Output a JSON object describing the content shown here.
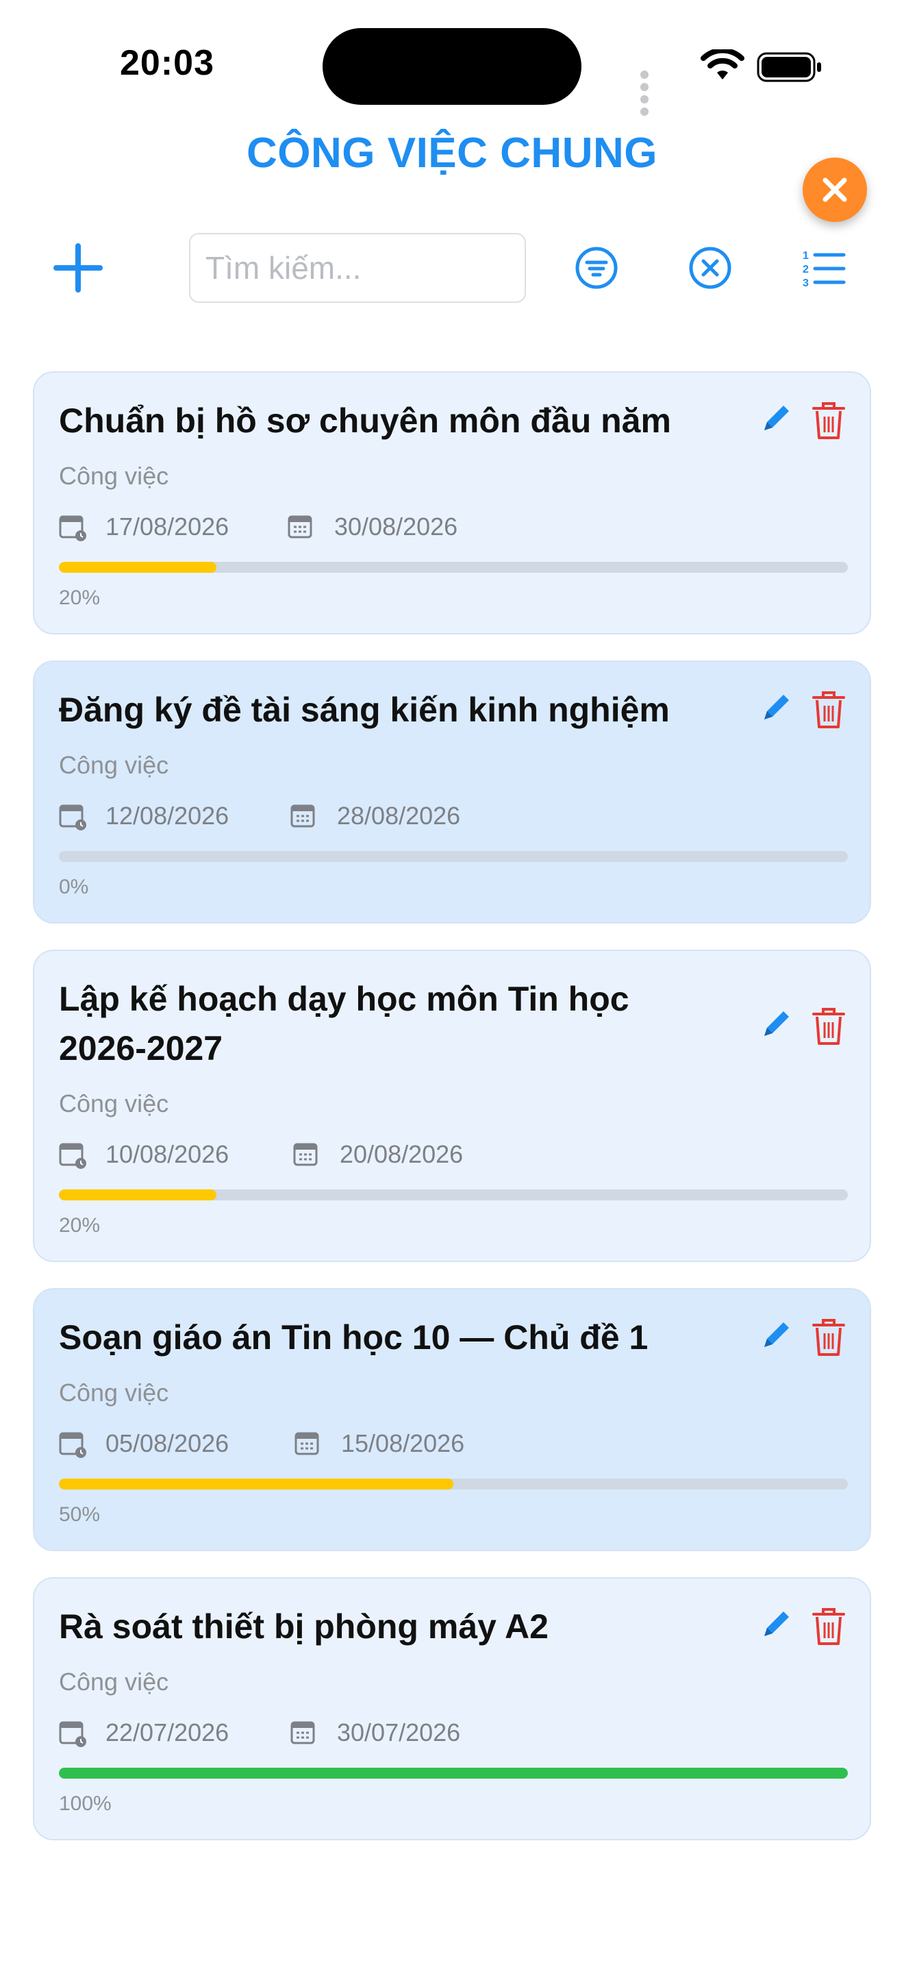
{
  "status": {
    "time": "20:03"
  },
  "header": {
    "title": "CÔNG VIỆC CHUNG"
  },
  "toolbar": {
    "search_placeholder": "Tìm kiếm..."
  },
  "colors": {
    "accent": "#1f8ef1",
    "close": "#ff8a2a",
    "delete": "#e53935",
    "progress_partial": "#ffc800",
    "progress_complete": "#2fbf4f"
  },
  "icons": {
    "add": "plus-icon",
    "filter": "filter-icon",
    "clear": "clear-circle-icon",
    "sort": "numbered-list-icon",
    "edit": "pencil-icon",
    "delete": "trash-icon",
    "start_date": "calendar-clock-icon",
    "end_date": "calendar-icon",
    "close": "close-icon"
  },
  "tasks": [
    {
      "title": "Chuẩn bị hồ sơ chuyên môn đầu năm",
      "category": "Công việc",
      "start": "17/08/2026",
      "end": "30/08/2026",
      "progress": 20,
      "progress_label": "20%"
    },
    {
      "title": "Đăng ký đề tài sáng kiến kinh nghiệm",
      "category": "Công việc",
      "start": "12/08/2026",
      "end": "28/08/2026",
      "progress": 0,
      "progress_label": "0%"
    },
    {
      "title": "Lập kế hoạch dạy học môn Tin học 2026-2027",
      "category": "Công việc",
      "start": "10/08/2026",
      "end": "20/08/2026",
      "progress": 20,
      "progress_label": "20%"
    },
    {
      "title": "Soạn giáo án Tin học 10 — Chủ đề 1",
      "category": "Công việc",
      "start": "05/08/2026",
      "end": "15/08/2026",
      "progress": 50,
      "progress_label": "50%"
    },
    {
      "title": "Rà soát thiết bị phòng máy A2",
      "category": "Công việc",
      "start": "22/07/2026",
      "end": "30/07/2026",
      "progress": 100,
      "progress_label": "100%"
    }
  ]
}
